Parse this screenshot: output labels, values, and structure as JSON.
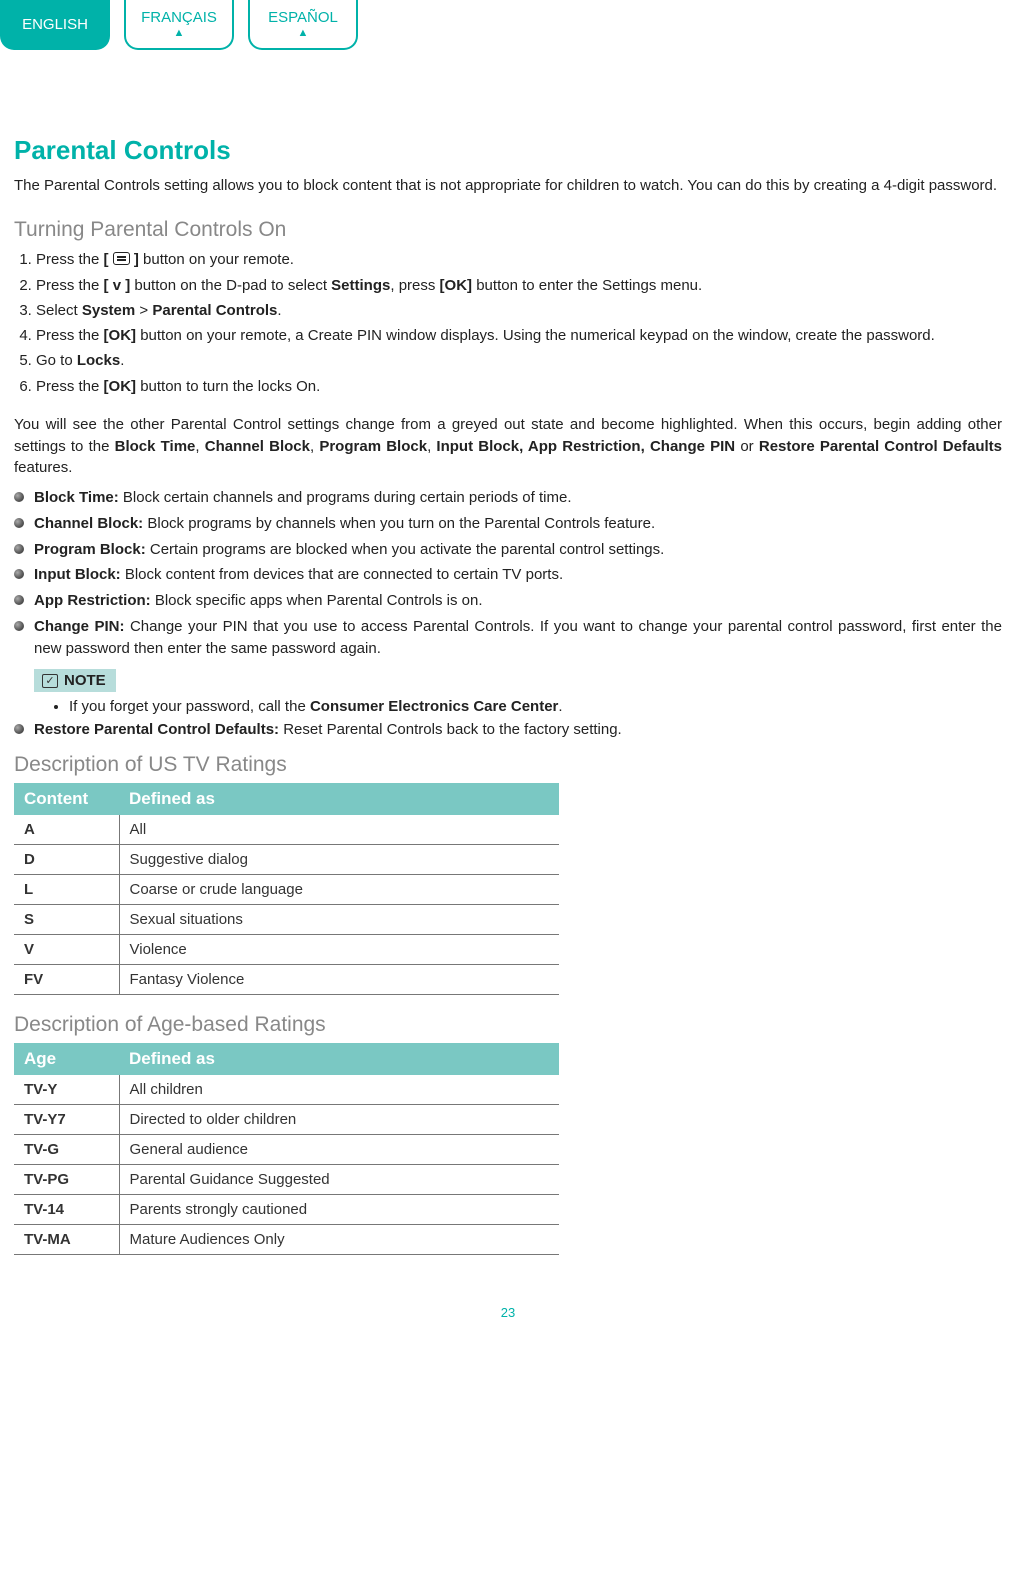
{
  "lang_tabs": {
    "english": "ENGLISH",
    "francais": "FRANÇAIS",
    "espanol": "ESPAÑOL"
  },
  "page_title": "Parental Controls",
  "intro": "The Parental Controls setting allows you to block content that is not appropriate for children to watch. You can do this by creating a 4-digit password.",
  "section_turn_on": "Turning Parental Controls On",
  "steps_html": [
    "Press the <b>[ <span class='remote-icon' data-name='remote-menu-icon' data-interactable='false'></span> ]</b> button on your remote.",
    "Press the <b>[ v ]</b> button on the D-pad to select <b>Settings</b>, press <b>[OK]</b> button to enter the Settings menu.",
    "Select <b>System</b> > <b>Parental Controls</b>.",
    "Press the <b>[OK]</b> button on your remote, a Create PIN window displays. Using the numerical keypad on the window, create the password.",
    "Go to <b>Locks</b>.",
    "Press the <b>[OK]</b> button to turn the locks On."
  ],
  "after_steps_html": "You will see the other Parental Control settings change from a greyed out state and become highlighted. When this occurs, begin adding other settings to the <b>Block Time</b>, <b>Channel Block</b>, <b>Program Block</b>, <b>Input Block, App Restriction, Change PIN</b> or <b>Restore Parental Control Defaults</b> features.",
  "features_html": [
    "<b>Block Time:</b> Block certain channels and programs during certain periods of time.",
    "<b>Channel Block:</b> Block programs by channels when you turn on the Parental Controls feature.",
    "<b>Program Block:</b> Certain programs are blocked when you activate the parental control settings.",
    "<b>Input Block:</b> Block content from devices that are connected to certain TV ports.",
    "<b>App Restriction:</b> Block specific apps when Parental Controls is on.",
    "<b>Change PIN:</b> Change your PIN that you use to access Parental Controls. If you want to change your parental control password, first enter the new password then enter the same password again."
  ],
  "note_label": "NOTE",
  "note_item_html": "If you forget your password, call the <b>Consumer Electronics Care Center</b>.",
  "restore_html": "<b>Restore Parental Control Defaults:</b> Reset Parental Controls back to the factory setting.",
  "section_us_ratings": "Description of US TV Ratings",
  "us_table": {
    "h1": "Content",
    "h2": "Defined as",
    "rows": [
      {
        "c": "A",
        "d": "All"
      },
      {
        "c": "D",
        "d": "Suggestive dialog"
      },
      {
        "c": "L",
        "d": "Coarse or crude language"
      },
      {
        "c": "S",
        "d": "Sexual situations"
      },
      {
        "c": "V",
        "d": "Violence"
      },
      {
        "c": "FV",
        "d": "Fantasy Violence"
      }
    ]
  },
  "section_age_ratings": "Description of Age-based Ratings",
  "age_table": {
    "h1": "Age",
    "h2": "Defined as",
    "rows": [
      {
        "c": "TV-Y",
        "d": "All children"
      },
      {
        "c": "TV-Y7",
        "d": "Directed to older children"
      },
      {
        "c": "TV-G",
        "d": "General audience"
      },
      {
        "c": "TV-PG",
        "d": "Parental Guidance Suggested"
      },
      {
        "c": "TV-14",
        "d": "Parents strongly cautioned"
      },
      {
        "c": "TV-MA",
        "d": "Mature Audiences Only"
      }
    ]
  },
  "page_number": "23"
}
